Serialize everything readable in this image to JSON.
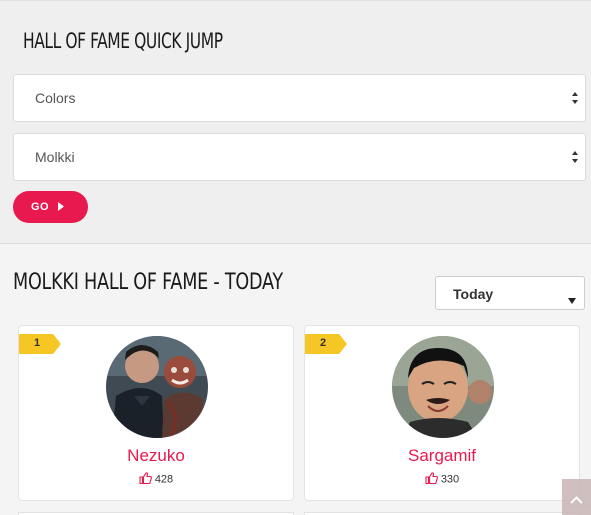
{
  "quick_jump": {
    "title": "HALL OF FAME QUICK JUMP",
    "category_select": {
      "value": "Colors"
    },
    "game_select": {
      "value": "Molkki"
    },
    "go_label": "GO"
  },
  "hall_of_fame": {
    "title": "MOLKKI HALL OF FAME - TODAY",
    "period_select": {
      "value": "Today"
    },
    "entries": [
      {
        "rank": "1",
        "name": "Nezuko",
        "likes": "428"
      },
      {
        "rank": "2",
        "name": "Sargamif",
        "likes": "330"
      }
    ]
  },
  "colors": {
    "accent": "#e8194f",
    "rank_badge": "#f6c624"
  },
  "icons": [
    "select-arrows-icon",
    "play-arrow-icon",
    "caret-down-icon",
    "thumbs-up-icon",
    "chevron-up-icon"
  ]
}
